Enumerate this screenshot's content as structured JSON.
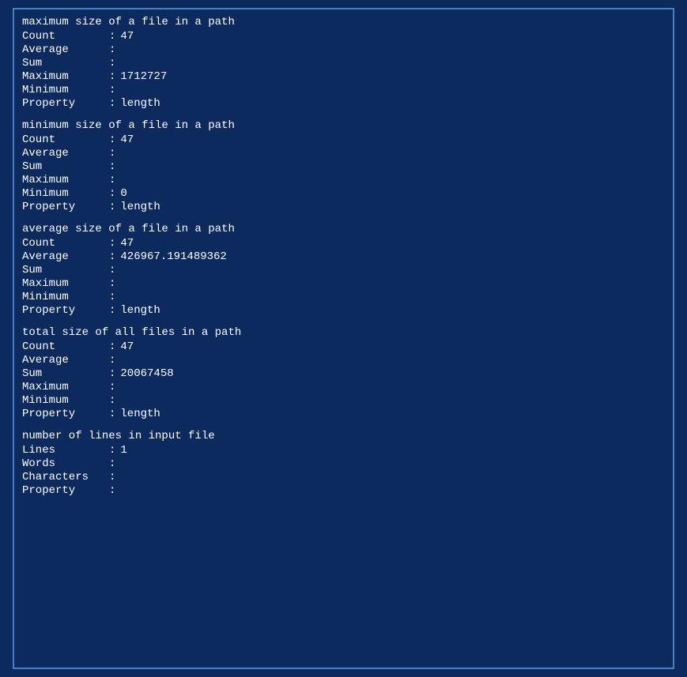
{
  "terminal": {
    "border_color": "#4a7fc1",
    "bg_color": "#0d2a5e"
  },
  "sections": [
    {
      "id": "max-file-size",
      "title": "maximum size of a file in a path",
      "rows": [
        {
          "label": "Count",
          "value": "47"
        },
        {
          "label": "Average",
          "value": ""
        },
        {
          "label": "Sum",
          "value": ""
        },
        {
          "label": "Maximum",
          "value": "1712727"
        },
        {
          "label": "Minimum",
          "value": ""
        },
        {
          "label": "Property",
          "value": "length"
        }
      ]
    },
    {
      "id": "min-file-size",
      "title": "minimum size of a file in a path",
      "rows": [
        {
          "label": "Count",
          "value": "47"
        },
        {
          "label": "Average",
          "value": ""
        },
        {
          "label": "Sum",
          "value": ""
        },
        {
          "label": "Maximum",
          "value": ""
        },
        {
          "label": "Minimum",
          "value": "0"
        },
        {
          "label": "Property",
          "value": "length"
        }
      ]
    },
    {
      "id": "avg-file-size",
      "title": "average size of a file in a path",
      "rows": [
        {
          "label": "Count",
          "value": "47"
        },
        {
          "label": "Average",
          "value": "426967.191489362"
        },
        {
          "label": "Sum",
          "value": ""
        },
        {
          "label": "Maximum",
          "value": ""
        },
        {
          "label": "Minimum",
          "value": ""
        },
        {
          "label": "Property",
          "value": "length"
        }
      ]
    },
    {
      "id": "total-file-size",
      "title": "total size of all files in a path",
      "rows": [
        {
          "label": "Count",
          "value": "47"
        },
        {
          "label": "Average",
          "value": ""
        },
        {
          "label": "Sum",
          "value": "20067458"
        },
        {
          "label": "Maximum",
          "value": ""
        },
        {
          "label": "Minimum",
          "value": ""
        },
        {
          "label": "Property",
          "value": "length"
        }
      ]
    },
    {
      "id": "lines-in-file",
      "title": "number of lines in input file",
      "rows": [
        {
          "label": "Lines",
          "value": "1"
        },
        {
          "label": "Words",
          "value": ""
        },
        {
          "label": "Characters",
          "value": ""
        },
        {
          "label": "Property",
          "value": ""
        }
      ]
    }
  ]
}
